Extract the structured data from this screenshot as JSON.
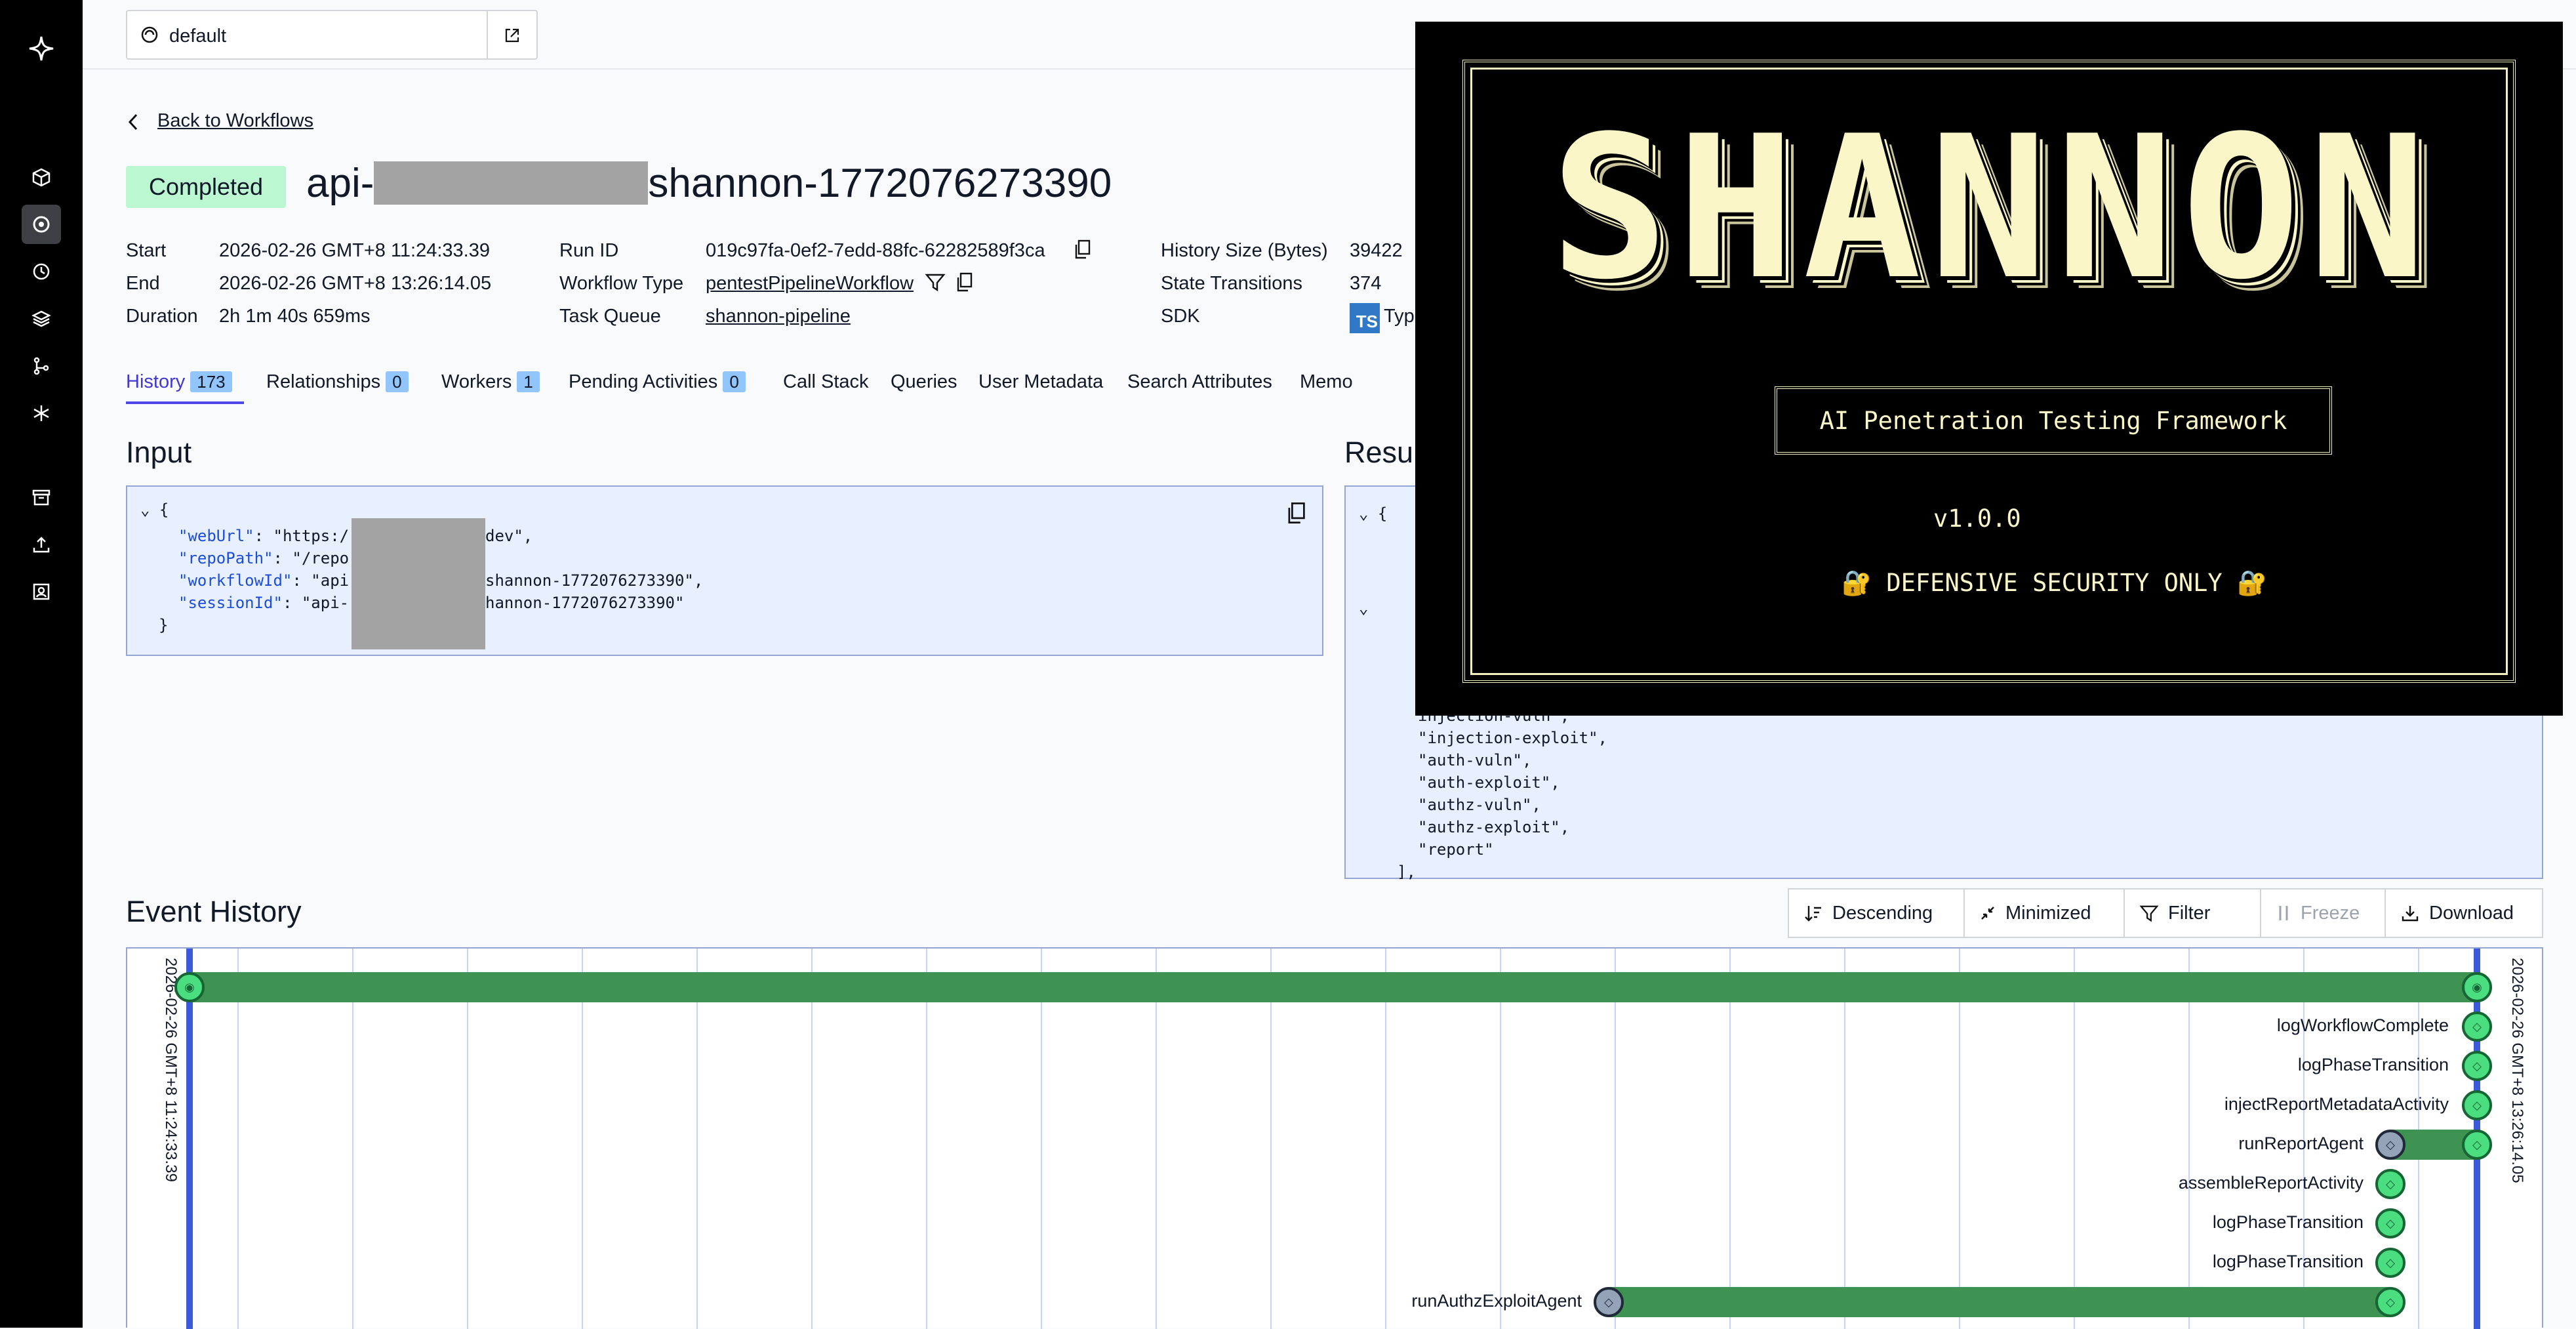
{
  "topbar": {
    "namespace": "default"
  },
  "header": {
    "back_label": "Back to Workflows",
    "status": "Completed",
    "title_prefix": "api-",
    "title_suffix": "shannon-1772076273390"
  },
  "details": {
    "start_label": "Start",
    "start_value": "2026-02-26 GMT+8 11:24:33.39",
    "end_label": "End",
    "end_value": "2026-02-26 GMT+8 13:26:14.05",
    "duration_label": "Duration",
    "duration_value": "2h 1m 40s 659ms",
    "run_id_label": "Run ID",
    "run_id_value": "019c97fa-0ef2-7edd-88fc-62282589f3ca",
    "workflow_type_label": "Workflow Type",
    "workflow_type_value": "pentestPipelineWorkflow",
    "task_queue_label": "Task Queue",
    "task_queue_value": "shannon-pipeline",
    "history_size_label": "History Size (Bytes)",
    "history_size_value": "39422",
    "state_transitions_label": "State Transitions",
    "state_transitions_value": "374",
    "sdk_label": "SDK",
    "sdk_badge": "TS",
    "sdk_value": "Typ"
  },
  "tabs": [
    {
      "label": "History",
      "count": "173"
    },
    {
      "label": "Relationships",
      "count": "0"
    },
    {
      "label": "Workers",
      "count": "1"
    },
    {
      "label": "Pending Activities",
      "count": "0"
    },
    {
      "label": "Call Stack"
    },
    {
      "label": "Queries"
    },
    {
      "label": "User Metadata"
    },
    {
      "label": "Search Attributes"
    },
    {
      "label": "Memo"
    }
  ],
  "input": {
    "title": "Input",
    "lines": [
      {
        "key": "\"webUrl\"",
        "val": ": \"https:/",
        "tail": "dev\","
      },
      {
        "key": "\"repoPath\"",
        "val": ": \"/repo",
        "tail": ""
      },
      {
        "key": "\"workflowId\"",
        "val": ": \"api",
        "tail": "shannon-1772076273390\","
      },
      {
        "key": "\"sessionId\"",
        "val": ": \"api-",
        "tail": "hannon-1772076273390\""
      }
    ]
  },
  "result": {
    "title": "Resu",
    "lines": [
      "injection-vuln\",",
      "\"injection-exploit\",",
      "\"auth-vuln\",",
      "\"auth-exploit\",",
      "\"authz-vuln\",",
      "\"authz-exploit\",",
      "\"report\"",
      "],"
    ]
  },
  "event_history": {
    "title": "Event History",
    "controls": {
      "descending": "Descending",
      "minimized": "Minimized",
      "filter": "Filter",
      "freeze": "Freeze",
      "download": "Download"
    },
    "start_time": "2026-02-26 GMT+8 11:24:33.39",
    "end_time": "2026-02-26 GMT+8 13:26:14.05",
    "events": [
      "logWorkflowComplete",
      "logPhaseTransition",
      "injectReportMetadataActivity",
      "runReportAgent",
      "assembleReportActivity",
      "logPhaseTransition",
      "logPhaseTransition",
      "runAuthzExploitAgent"
    ]
  },
  "banner": {
    "logo": "SHANNON",
    "tagline": "AI Penetration Testing Framework",
    "version": "v1.0.0",
    "notice": "🔐 DEFENSIVE SECURITY ONLY 🔐"
  },
  "colors": {
    "accent": "#4f46e5",
    "status_completed": "#bbf7d0",
    "bar_green": "#3f9352",
    "banner_text": "#fbf6c8"
  }
}
